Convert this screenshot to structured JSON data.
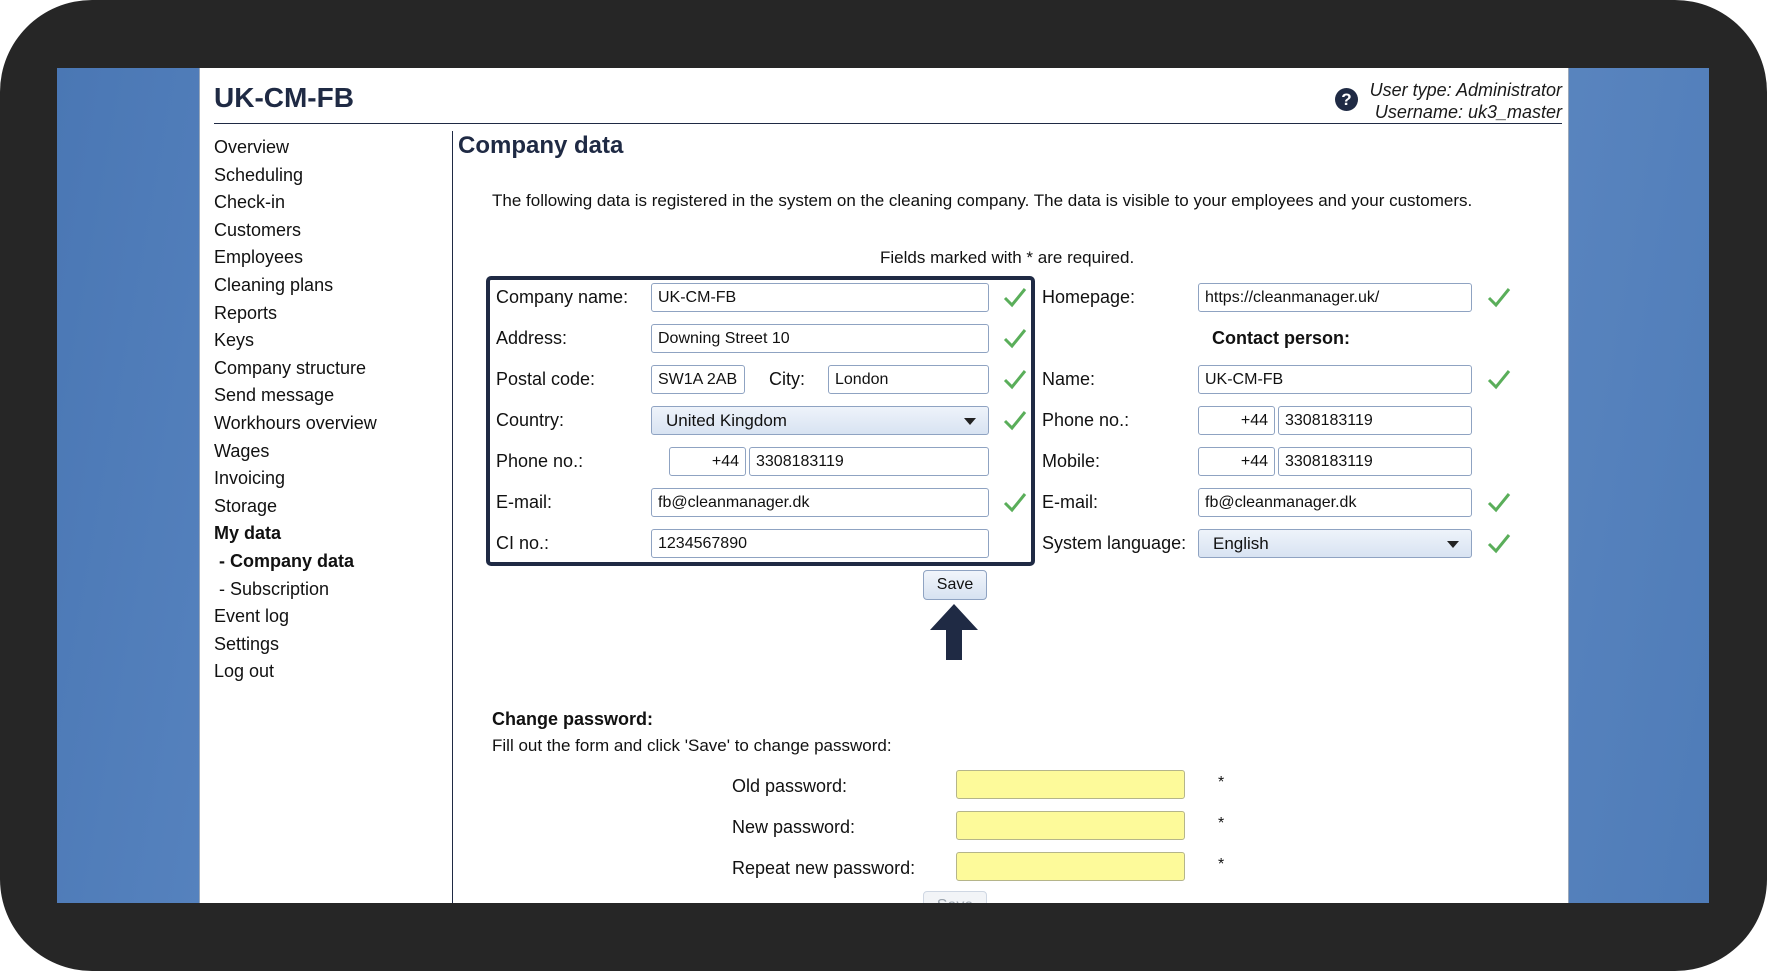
{
  "header": {
    "app_title": "UK-CM-FB",
    "user_type": "User type: Administrator",
    "username": "Username: uk3_master"
  },
  "sidebar": {
    "items": [
      {
        "label": "Overview"
      },
      {
        "label": "Scheduling"
      },
      {
        "label": "Check-in"
      },
      {
        "label": "Customers"
      },
      {
        "label": "Employees"
      },
      {
        "label": "Cleaning plans"
      },
      {
        "label": "Reports"
      },
      {
        "label": "Keys"
      },
      {
        "label": "Company structure"
      },
      {
        "label": "Send message"
      },
      {
        "label": "Workhours overview"
      },
      {
        "label": "Wages"
      },
      {
        "label": "Invoicing"
      },
      {
        "label": "Storage"
      },
      {
        "label": "My data"
      },
      {
        "label": "- Company data"
      },
      {
        "label": "- Subscription"
      },
      {
        "label": "Event log"
      },
      {
        "label": "Settings"
      },
      {
        "label": "Log out"
      }
    ]
  },
  "main": {
    "title": "Company data",
    "intro": "The following data is registered in the system on the cleaning company. The data is visible to your employees and your customers.",
    "required_note": "Fields marked with * are required.",
    "company": {
      "name_label": "Company name:",
      "name_value": "UK-CM-FB",
      "address_label": "Address:",
      "address_value": "Downing Street 10",
      "postal_label": "Postal code:",
      "postal_value": "SW1A 2AB",
      "city_label": "City:",
      "city_value": "London",
      "country_label": "Country:",
      "country_value": "United Kingdom",
      "phone_label": "Phone no.:",
      "phone_prefix": "+44",
      "phone_value": "3308183119",
      "email_label": "E-mail:",
      "email_value": "fb@cleanmanager.dk",
      "ci_label": "CI no.:",
      "ci_value": "1234567890"
    },
    "contact": {
      "homepage_label": "Homepage:",
      "homepage_value": "https://cleanmanager.uk/",
      "section_title": "Contact person:",
      "name_label": "Name:",
      "name_value": "UK-CM-FB",
      "phone_label": "Phone no.:",
      "phone_prefix": "+44",
      "phone_value": "3308183119",
      "mobile_label": "Mobile:",
      "mobile_prefix": "+44",
      "mobile_value": "3308183119",
      "email_label": "E-mail:",
      "email_value": "fb@cleanmanager.dk",
      "language_label": "System language:",
      "language_value": "English"
    },
    "save_label": "Save",
    "password": {
      "title": "Change password:",
      "note": "Fill out the form and click 'Save' to change password:",
      "old_label": "Old password:",
      "new_label": "New password:",
      "repeat_label": "Repeat new password:",
      "required_mark": "*",
      "save_label": "Save"
    }
  },
  "colors": {
    "accent": "#1f2a44",
    "check": "#5aae5a",
    "password_field": "#fdfa9a",
    "backdrop": "#5f8bc6"
  }
}
